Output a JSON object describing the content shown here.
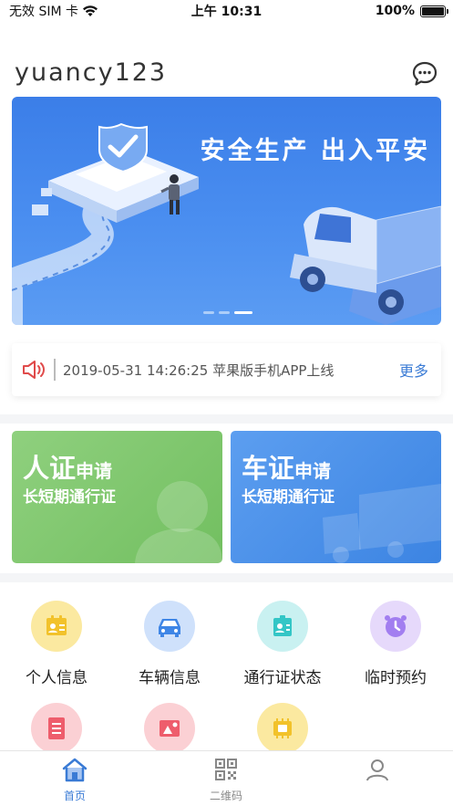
{
  "status_bar": {
    "carrier": "无效 SIM 卡",
    "time": "上午 10:31",
    "battery_text": "100%",
    "battery_level": 1.0
  },
  "header": {
    "username": "yuancy123",
    "message_icon": "chat-bubble-icon"
  },
  "banner": {
    "title": "安全生产 出入平安",
    "page_count": 3,
    "active_page": 3
  },
  "notice": {
    "icon": "speaker-icon",
    "text": "2019-05-31 14:26:25 苹果版手机APP上线",
    "more_label": "更多"
  },
  "cards": [
    {
      "title_big": "人证",
      "title_small": "申请",
      "subtitle": "长短期通行证",
      "color": "#7cc66a"
    },
    {
      "title_big": "车证",
      "title_small": "申请",
      "subtitle": "长短期通行证",
      "color": "#4a8fe8"
    }
  ],
  "menu": [
    {
      "label": "个人信息",
      "icon": "id-card-icon",
      "bg": "#fbe9a0",
      "fg": "#f2c22b"
    },
    {
      "label": "车辆信息",
      "icon": "car-icon",
      "bg": "#cfe1fb",
      "fg": "#3f86e6"
    },
    {
      "label": "通行证状态",
      "icon": "badge-icon",
      "bg": "#c9f1f1",
      "fg": "#33c6c6"
    },
    {
      "label": "临时预约",
      "icon": "clock-icon",
      "bg": "#e6d9fb",
      "fg": "#a27ef0"
    },
    {
      "label": "",
      "icon": "document-icon",
      "bg": "#fbd0d4",
      "fg": "#ee5d6c"
    },
    {
      "label": "",
      "icon": "photo-icon",
      "bg": "#fbd0d4",
      "fg": "#ee5d6c"
    },
    {
      "label": "",
      "icon": "chip-icon",
      "bg": "#fbe9a0",
      "fg": "#f2c22b"
    }
  ],
  "tabs": [
    {
      "label": "首页",
      "icon": "home-icon",
      "active": true
    },
    {
      "label": "二维码",
      "icon": "qrcode-icon",
      "active": false
    },
    {
      "label": "",
      "icon": "profile-icon",
      "active": false
    }
  ],
  "colors": {
    "accent": "#3a7bd5",
    "banner": "#4a8ef0",
    "notice_icon": "#e04b4b"
  }
}
